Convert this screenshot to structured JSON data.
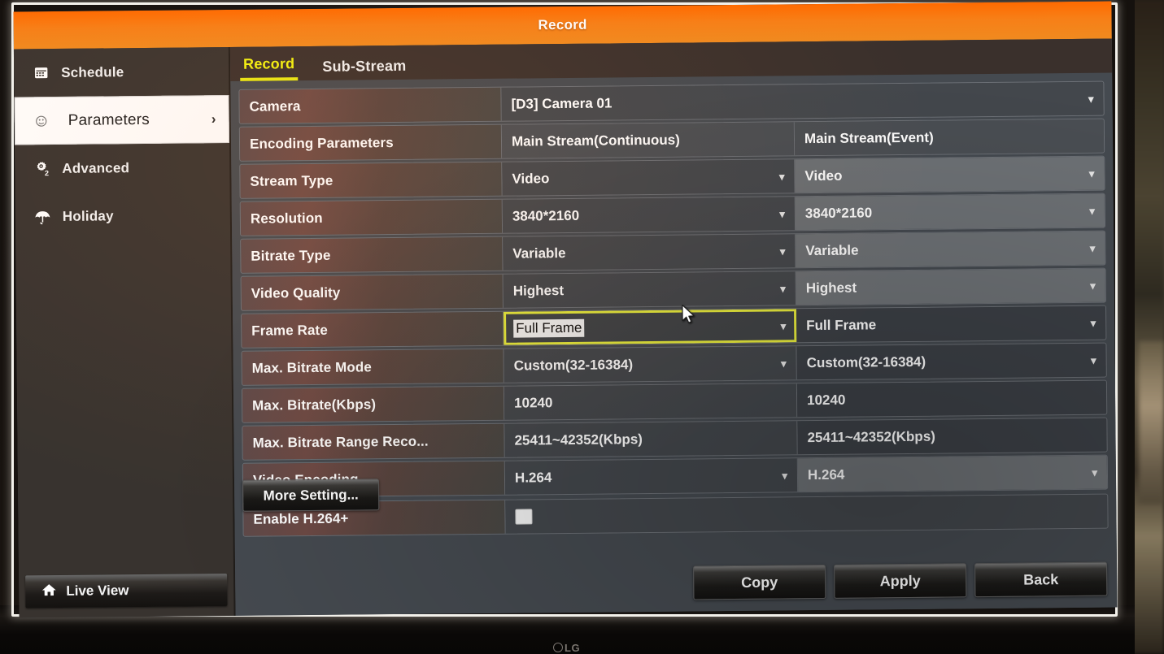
{
  "window": {
    "title": "Record"
  },
  "sidebar": {
    "items": [
      {
        "label": "Schedule",
        "icon": "calendar-icon",
        "active": false
      },
      {
        "label": "Parameters",
        "icon": "settings-icon",
        "active": true,
        "chevron": "›"
      },
      {
        "label": "Advanced",
        "icon": "gear2-icon",
        "active": false
      },
      {
        "label": "Holiday",
        "icon": "umbrella-icon",
        "active": false
      }
    ],
    "live_view": {
      "label": "Live View",
      "icon": "home-icon"
    }
  },
  "tabs": [
    {
      "label": "Record",
      "active": true
    },
    {
      "label": "Sub-Stream",
      "active": false
    }
  ],
  "form": {
    "camera": {
      "label": "Camera",
      "value": "[D3] Camera 01"
    },
    "columns": {
      "label": "Encoding Parameters",
      "col_a": "Main Stream(Continuous)",
      "col_b": "Main Stream(Event)"
    },
    "rows": [
      {
        "label": "Stream Type",
        "a": "Video",
        "b": "Video",
        "dropdown": true
      },
      {
        "label": "Resolution",
        "a": "3840*2160",
        "b": "3840*2160",
        "dropdown": true
      },
      {
        "label": "Bitrate Type",
        "a": "Variable",
        "b": "Variable",
        "dropdown": true
      },
      {
        "label": "Video Quality",
        "a": "Highest",
        "b": "Highest",
        "dropdown": true
      },
      {
        "label": "Frame Rate",
        "a": "Full Frame",
        "b": "Full Frame",
        "dropdown": true,
        "focused": true
      },
      {
        "label": "Max. Bitrate Mode",
        "a": "Custom(32-16384)",
        "b": "Custom(32-16384)",
        "dropdown": true
      },
      {
        "label": "Max. Bitrate(Kbps)",
        "a": "10240",
        "b": "10240",
        "dropdown": false
      },
      {
        "label": "Max. Bitrate Range Reco...",
        "a": "25411~42352(Kbps)",
        "b": "25411~42352(Kbps)",
        "dropdown": false
      },
      {
        "label": "Video Encoding",
        "a": "H.264",
        "b": "H.264",
        "dropdown": true
      }
    ],
    "enable_h264plus": {
      "label": "Enable H.264+",
      "checked": false
    }
  },
  "buttons": {
    "more_setting": "More Setting...",
    "copy": "Copy",
    "apply": "Apply",
    "back": "Back"
  },
  "monitor": {
    "brand": "LG"
  },
  "colors": {
    "titlebar_orange": "#f77f17",
    "active_tab_yellow": "#f2f411",
    "focus_outline": "#e9ee3d",
    "sidebar_bg": "#38332f",
    "content_bg": "#454a50"
  }
}
